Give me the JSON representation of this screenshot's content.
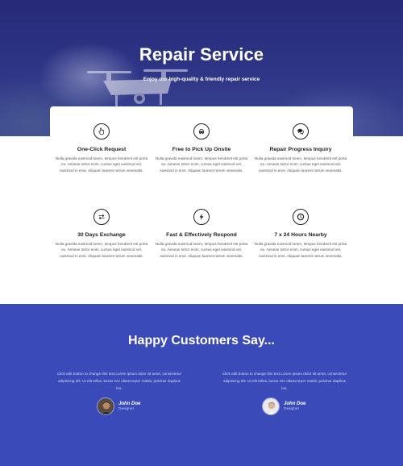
{
  "hero": {
    "title": "Repair Service",
    "subtitle": "Enjoy our high-quality & friendly repair service"
  },
  "features": [
    {
      "icon": "hand-pointer-icon",
      "title": "One-Click Request",
      "desc": "Nulla gravida euismod lorem, tempus hendrerit est porta eu. Aenean tortor enim, cursus eget euismod vel, euismod in eros. Aliquam laoreet rutrum venenatis."
    },
    {
      "icon": "car-icon",
      "title": "Free to Pick Up Onsite",
      "desc": "Nulla gravida euismod lorem, tempus hendrerit est porta eu. Aenean tortor enim, cursus eget euismod vel, euismod in eros. Aliquam laoreet rutrum venenatis."
    },
    {
      "icon": "chat-bubbles-icon",
      "title": "Repair Progress Inquiry",
      "desc": "Nulla gravida euismod lorem, tempus hendrerit est porta eu. Aenean tortor enim, cursus eget euismod vel, euismod in eros. Aliquam laoreet rutrum venenatis."
    },
    {
      "icon": "exchange-arrows-icon",
      "title": "30 Days Exchange",
      "desc": "Nulla gravida euismod lorem, tempus hendrerit est porta eu. Aenean tortor enim, cursus eget euismod vel, euismod in eros. Aliquam laoreet rutrum venenatis."
    },
    {
      "icon": "lightning-bolt-icon",
      "title": "Fast & Effectively Respond",
      "desc": "Nulla gravida euismod lorem, tempus hendrerit est porta eu. Aenean tortor enim, cursus eget euismod vel, euismod in eros. Aliquam laoreet rutrum venenatis."
    },
    {
      "icon": "clock-icon",
      "title": "7 x 24 Hours Nearby",
      "desc": "Nulla gravida euismod lorem, tempus hendrerit est porta eu. Aenean tortor enim, cursus eget euismod vel, euismod in eros. Aliquam laoreet rutrum venenatis."
    }
  ],
  "testimonials": {
    "title": "Happy Customers Say...",
    "items": [
      {
        "quote": "Click edit button to change this text.Lorem ipsum dolor sit amet, consectetur adipiscing elit. Ut elit tellus, luctus nec ullamcorper mattis, pulvinar dapibus leo.",
        "name": "John Doe",
        "role": "Designer"
      },
      {
        "quote": "Click edit button to change this text.Lorem ipsum dolor sit amet, consectetur adipiscing elit. Ut elit tellus, luctus nec ullamcorper mattis, pulvinar dapibus leo.",
        "name": "John Doe",
        "role": "Designer"
      }
    ]
  },
  "colors": {
    "hero_bg": "#2a2f80",
    "testimonials_bg": "#3a4ab9",
    "card_bg": "#ffffff"
  }
}
